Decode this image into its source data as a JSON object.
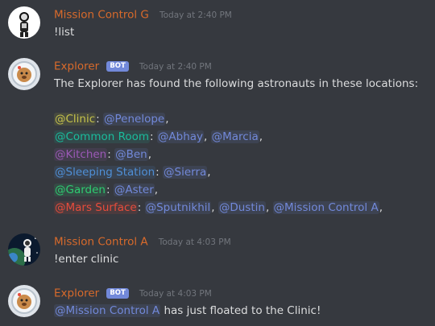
{
  "messages": [
    {
      "author": "Mission Control G",
      "author_color": "#d86a2b",
      "timestamp": "Today at 2:40 PM",
      "avatar": "astronaut-avatar-icon",
      "text": "!list"
    },
    {
      "author": "Explorer",
      "author_color": "#d86a2b",
      "bot_badge": "BOT",
      "timestamp": "Today at 2:40 PM",
      "avatar": "dog-astronaut-avatar-icon",
      "intro": "The Explorer has found the following astronauts in these locations:",
      "locations": [
        {
          "role": "@Clinic",
          "color": "#c6c34a",
          "members": [
            "@Penelope"
          ]
        },
        {
          "role": "@Common Room",
          "color": "#1abc9c",
          "members": [
            "@Abhay",
            "@Marcia"
          ]
        },
        {
          "role": "@Kitchen",
          "color": "#9b59b6",
          "members": [
            "@Ben"
          ]
        },
        {
          "role": "@Sleeping Station",
          "color": "#4f8fd6",
          "members": [
            "@Sierra"
          ]
        },
        {
          "role": "@Garden",
          "color": "#2ecc71",
          "members": [
            "@Aster"
          ]
        },
        {
          "role": "@Mars Surface",
          "color": "#e74c3c",
          "members": [
            "@Sputnikhil",
            "@Dustin",
            "@Mission Control A"
          ]
        }
      ]
    },
    {
      "author": "Mission Control A",
      "author_color": "#d86a2b",
      "timestamp": "Today at 4:03 PM",
      "avatar": "astronaut-planet-avatar-icon",
      "text": "!enter clinic"
    },
    {
      "author": "Explorer",
      "author_color": "#d86a2b",
      "bot_badge": "BOT",
      "timestamp": "Today at 4:03 PM",
      "avatar": "dog-astronaut-avatar-icon",
      "mention": "@Mission Control A",
      "text": " has just floated to the Clinic!"
    }
  ]
}
